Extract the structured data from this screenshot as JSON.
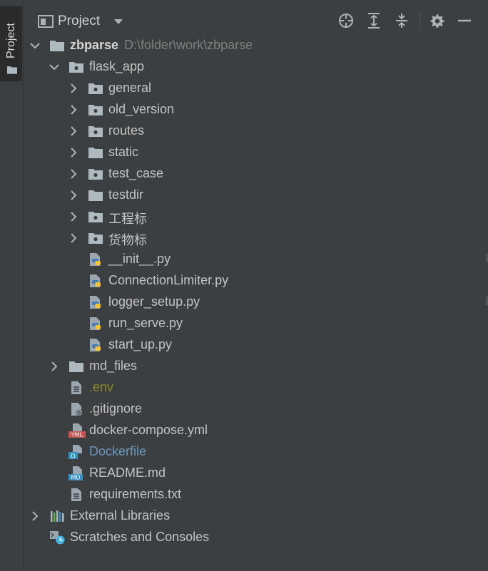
{
  "sidebar": {
    "tab_label": "Project"
  },
  "header": {
    "title": "Project",
    "icons": [
      "locate-icon",
      "expand-all-icon",
      "collapse-all-icon",
      "settings-icon",
      "hide-icon"
    ]
  },
  "tree": {
    "root": {
      "name": "zbparse",
      "path": "D:\\folder\\work\\zbparse"
    },
    "flask_app": "flask_app",
    "folders": [
      "general",
      "old_version",
      "routes",
      "static",
      "test_case",
      "testdir",
      "工程标",
      "货物标"
    ],
    "py_files": [
      "__init__.py",
      "ConnectionLimiter.py",
      "logger_setup.py",
      "run_serve.py",
      "start_up.py"
    ],
    "md_files": "md_files",
    "root_files": [
      ".env",
      ".gitignore",
      "docker-compose.yml",
      "Dockerfile",
      "README.md",
      "requirements.txt"
    ],
    "external_libraries": "External Libraries",
    "scratches": "Scratches and Consoles"
  },
  "colors": {
    "background": "#3c3f41",
    "text": "#c3c3c3",
    "path": "#7f7f7f",
    "env_text": "#8a8a27",
    "dockerfile_text": "#6897bb"
  }
}
